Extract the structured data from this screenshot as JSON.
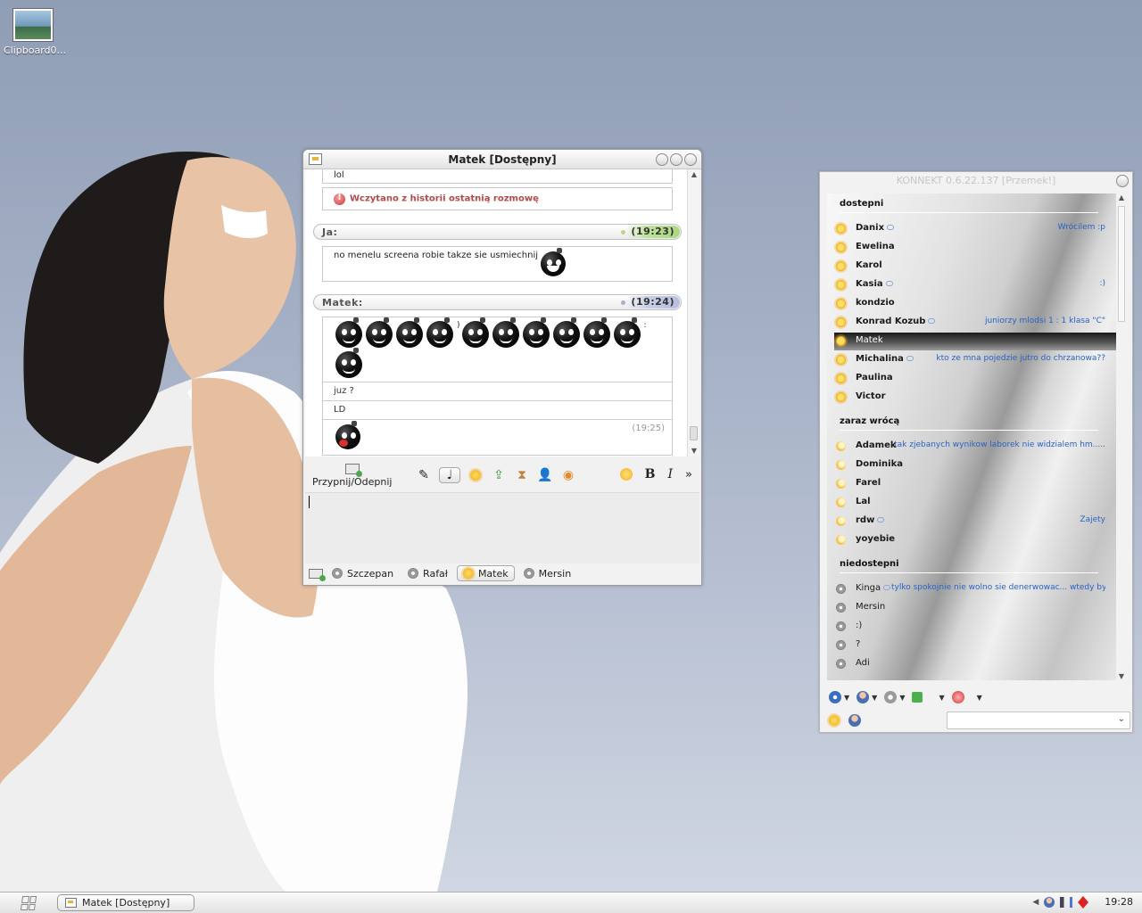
{
  "desktop": {
    "icon_label": "Clipboard0..."
  },
  "chat_window": {
    "title": "Matek [Dostępny]",
    "history": {
      "top_message": "lol",
      "info_message": "Wczytano z historii ostatnią rozmowę",
      "messages": [
        {
          "sender": "Ja:",
          "time": "(19:23)",
          "text": "no menelu screena robie takze sie usmiechnij"
        },
        {
          "sender": "Matek:",
          "time": "(19:24)",
          "lines": [
            ")",
            ":",
            "juz ?",
            "LD",
            "(19:25)"
          ]
        }
      ]
    },
    "toolbar": {
      "pin_label": "Przypnij/Odepnij",
      "bold": "B",
      "italic": "I",
      "more": "»"
    },
    "input_value": "",
    "tabs": [
      {
        "label": "Szczepan",
        "active": false
      },
      {
        "label": "Rafał",
        "active": false
      },
      {
        "label": "Matek",
        "active": true
      },
      {
        "label": "Mersin",
        "active": false
      }
    ]
  },
  "contact_list": {
    "title": "KONNEKT 0.6.22.137 [Przemek!]",
    "groups": [
      {
        "name": "dostepni",
        "contacts": [
          {
            "name": "Danix",
            "status": "Wrócilem :p",
            "bubble": true
          },
          {
            "name": "Ewelina",
            "status": ""
          },
          {
            "name": "Karol",
            "status": ""
          },
          {
            "name": "Kasia",
            "status": ":)",
            "bubble": true
          },
          {
            "name": "kondzio",
            "status": ""
          },
          {
            "name": "Konrad Kozub",
            "status": "juniorzy mlodsi 1 : 1 klasa \"C\"",
            "bubble": true
          },
          {
            "name": "Matek",
            "status": "",
            "selected": true
          },
          {
            "name": "Michalina",
            "status": "kto ze mna pojedzie jutro do chrzanowa??",
            "bubble": true
          },
          {
            "name": "Paulina",
            "status": ""
          },
          {
            "name": "Victor",
            "status": ""
          }
        ]
      },
      {
        "name": "zaraz wrócą",
        "contacts": [
          {
            "name": "Adamek",
            "status": "tak zjebanych wynikow laborek nie widzialem hm....."
          },
          {
            "name": "Dominika",
            "status": ""
          },
          {
            "name": "Farel",
            "status": ""
          },
          {
            "name": "Lal",
            "status": ""
          },
          {
            "name": "rdw",
            "status": "Zajety",
            "bubble": true
          },
          {
            "name": "yoyebie",
            "status": ""
          }
        ]
      },
      {
        "name": "niedostepni",
        "contacts": [
          {
            "name": "Kinga",
            "status": "tylko spokojnie nie wolno sie denerwowac... wtedy by...",
            "bubble": true
          },
          {
            "name": "Mersin",
            "status": ""
          },
          {
            "name": ":)",
            "status": ""
          },
          {
            "name": "?",
            "status": ""
          },
          {
            "name": "Adi",
            "status": ""
          }
        ]
      }
    ],
    "status_select_value": ""
  },
  "taskbar": {
    "task_label": "Matek [Dostępny]",
    "clock": "19:28"
  }
}
